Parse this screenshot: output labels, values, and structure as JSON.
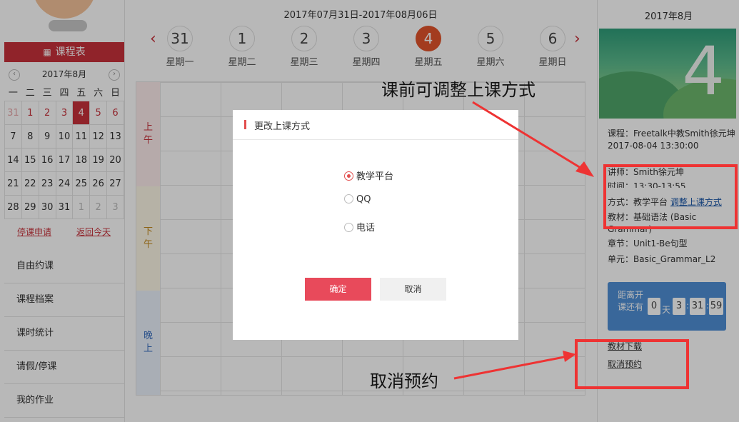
{
  "left": {
    "schedule_title": "课程表",
    "calendar": {
      "month_label": "2017年8月",
      "prev_arrow": "‹",
      "next_arrow": "›",
      "weekdays": [
        "一",
        "二",
        "三",
        "四",
        "五",
        "六",
        "日"
      ],
      "rows": [
        [
          "31",
          "1",
          "2",
          "3",
          "4",
          "5",
          "6"
        ],
        [
          "7",
          "8",
          "9",
          "10",
          "11",
          "12",
          "13"
        ],
        [
          "14",
          "15",
          "16",
          "17",
          "18",
          "19",
          "20"
        ],
        [
          "21",
          "22",
          "23",
          "24",
          "25",
          "26",
          "27"
        ],
        [
          "28",
          "29",
          "30",
          "31",
          "1",
          "2",
          "3"
        ]
      ]
    },
    "links": {
      "pause_request": "停课申请",
      "back_today": "返回今天"
    },
    "nav": [
      "自由约课",
      "课程档案",
      "课时统计",
      "请假/停课",
      "我的作业"
    ]
  },
  "center": {
    "date_range": "2017年07月31日-2017年08月06日",
    "prev_arrow": "‹",
    "next_arrow": "›",
    "days": [
      {
        "num": "31",
        "label": "星期一"
      },
      {
        "num": "1",
        "label": "星期二"
      },
      {
        "num": "2",
        "label": "星期三"
      },
      {
        "num": "3",
        "label": "星期四"
      },
      {
        "num": "4",
        "label": "星期五"
      },
      {
        "num": "5",
        "label": "星期六"
      },
      {
        "num": "6",
        "label": "星期日"
      }
    ],
    "periods": {
      "morning": "上午",
      "afternoon": "下午",
      "evening": "晚上"
    },
    "colors": {
      "morning_bg": "#fdecec",
      "morning_text": "#c8313b",
      "afternoon_bg": "#fdf7e6",
      "afternoon_text": "#c48a1e",
      "evening_bg": "#eaf1fb",
      "evening_text": "#3a6fc0"
    }
  },
  "right": {
    "month": "2017年8月",
    "big_day": "4",
    "course_label": "课程：",
    "course_value": "Freetalk中教Smith徐元坤 2017-08-04 13:30:00",
    "teacher_label": "讲师：",
    "teacher_value": "Smith徐元坤",
    "time_label": "时间：",
    "time_value": "13:30-13:55",
    "mode_label": "方式：",
    "mode_value": "教学平台",
    "mode_link": "调整上课方式",
    "material_label": "教材：",
    "material_value": "基础语法 (Basic Grammar)",
    "chapter_label": "章节：",
    "chapter_value": "Unit1-Be句型",
    "unit_label": "单元：",
    "unit_value": "Basic_Grammar_L2",
    "countdown": {
      "label": "距离开课还有",
      "days": "0",
      "day_unit": "天",
      "hours": "3",
      "minutes": "31",
      "seconds": "59",
      "sep": ":"
    },
    "download_link": "教材下载",
    "cancel_link": "取消预约"
  },
  "modal": {
    "title": "更改上课方式",
    "options": [
      {
        "label": "教学平台",
        "selected": true
      },
      {
        "label": "QQ",
        "selected": false
      },
      {
        "label": "电话",
        "selected": false
      }
    ],
    "ok": "确定",
    "cancel": "取消"
  },
  "annotations": {
    "adjust_note": "课前可调整上课方式",
    "cancel_note": "取消预约",
    "color": "#ee3333"
  }
}
